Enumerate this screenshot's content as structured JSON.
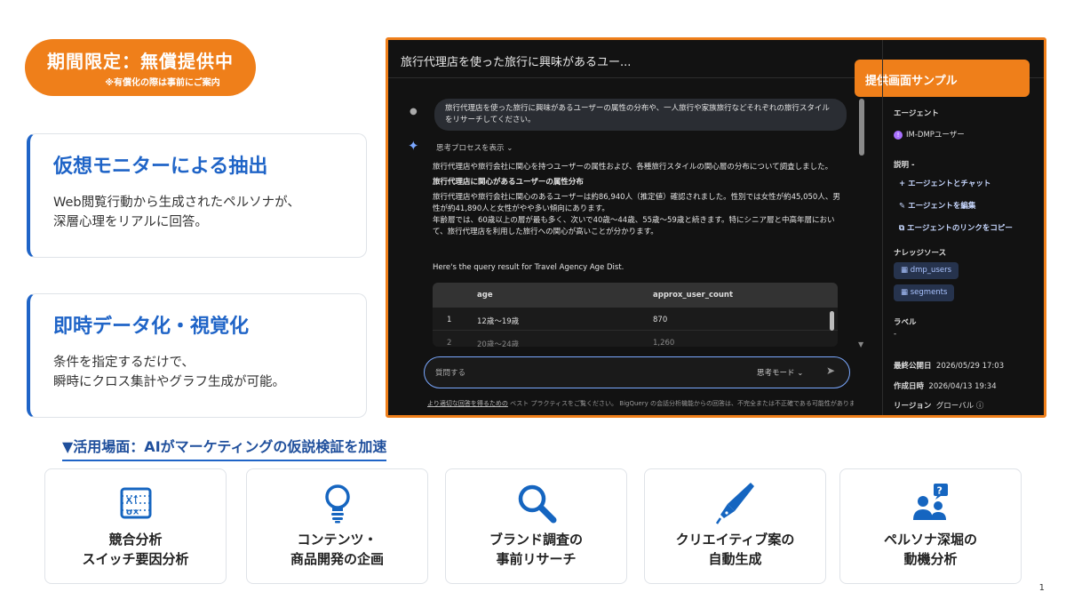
{
  "badge": {
    "main": "期間限定：無償提供中",
    "sub": "※有償化の際は事前にご案内"
  },
  "cards": [
    {
      "title": "仮想モニターによる抽出",
      "body": "Web閲覧行動から生成されたペルソナが、\n深層心理をリアルに回答。"
    },
    {
      "title": "即時データ化・視覚化",
      "body": "条件を指定するだけで、\n瞬時にクロス集計やグラフ生成が可能。"
    }
  ],
  "screenshot": {
    "title": "旅行代理店を使った旅行に興味があるユー...",
    "sample_tag": "提供画面サンプル",
    "user_message": "旅行代理店を使った旅行に興味があるユーザーの属性の分布や、一人旅行や家族旅行などそれぞれの旅行スタイルをリサーチしてください。",
    "thinking_label": "思考プロセスを表示 ⌄",
    "response_intro": "旅行代理店や旅行会社に関心を持つユーザーの属性および、各種旅行スタイルの関心層の分布について調査しました。",
    "response_heading": "旅行代理店に関心があるユーザーの属性分布",
    "response_body1": "旅行代理店や旅行会社に関心のあるユーザーは約86,940人（推定値）確認されました。性別では女性が約45,050人、男性が約41,890人と女性がやや多い傾向にあります。",
    "response_body2": "年齢層では、60歳以上の層が最も多く、次いで40歳〜44歳、55歳〜59歳と続きます。特にシニア層と中高年層において、旅行代理店を利用した旅行への関心が高いことが分かります。",
    "query_line": "Here's the query result for Travel Agency Age Dist.",
    "table": {
      "headers": [
        "age",
        "approx_user_count"
      ],
      "rows": [
        {
          "n": "1",
          "age": "12歳〜19歳",
          "count": "870"
        },
        {
          "n": "2",
          "age": "20歳〜24歳",
          "count": "1,260"
        }
      ]
    },
    "input_placeholder": "質問する",
    "mode_label": "思考モード ⌄",
    "footer_link": "より適切な回答を得るための",
    "footer_text": "ベスト プラクティスをご覧ください。 BigQuery の会話分析機能からの回答は、不完全または不正確である可能性がありま",
    "side": {
      "agent_label": "エージェント",
      "agent_name": "IM-DMPユーザー",
      "desc_label": "説明",
      "desc_value": "-",
      "actions": [
        "エージェントとチャット",
        "エージェントを編集",
        "エージェントのリンクをコピー"
      ],
      "knowledge_label": "ナレッジソース",
      "sources": [
        "dmp_users",
        "segments"
      ],
      "label_label": "ラベル",
      "label_value": "-",
      "published_label": "最終公開日",
      "published_value": "2026/05/29 17:03",
      "created_label": "作成日時",
      "created_value": "2026/04/13 19:34",
      "region_label": "リージョン",
      "region_value": "グローバル ⓘ"
    }
  },
  "usecase_title": "▼活用場面：AIがマーケティングの仮説検証を加速",
  "usecases": [
    {
      "label": "競合分析\nスイッチ要因分析",
      "icon": "comparison-icon"
    },
    {
      "label": "コンテンツ・\n商品開発の企画",
      "icon": "lightbulb-icon"
    },
    {
      "label": "ブランド調査の\n事前リサーチ",
      "icon": "magnifier-icon"
    },
    {
      "label": "クリエイティブ案の\n自動生成",
      "icon": "pen-icon"
    },
    {
      "label": "ペルソナ深堀の\n動機分析",
      "icon": "persona-question-icon"
    }
  ],
  "page_number": "1",
  "colors": {
    "accent": "#ef7f1a",
    "brand_blue": "#1f64c7",
    "icon_blue": "#1565c0"
  }
}
